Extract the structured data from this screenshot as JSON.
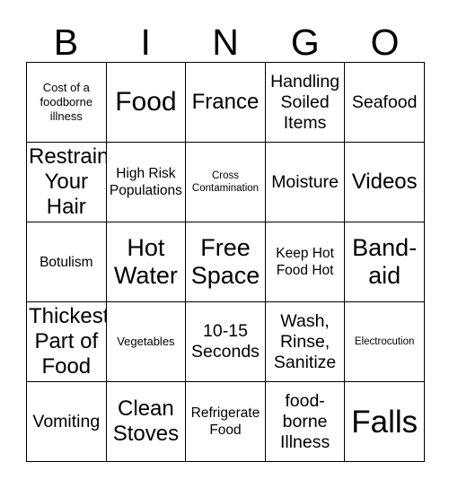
{
  "card": {
    "header_letters": [
      "B",
      "I",
      "N",
      "G",
      "O"
    ],
    "rows": [
      [
        {
          "text": "Cost of a foodborne illness",
          "size": "sz-s"
        },
        {
          "text": "Food",
          "size": "sz-3xl"
        },
        {
          "text": "France",
          "size": "sz-xl"
        },
        {
          "text": "Handling Soiled Items",
          "size": "sz-l"
        },
        {
          "text": "Seafood",
          "size": "sz-l"
        }
      ],
      [
        {
          "text": "Restrain Your Hair",
          "size": "sz-xl"
        },
        {
          "text": "High Risk Populations",
          "size": "sz-m"
        },
        {
          "text": "Cross Contamination",
          "size": "sz-xs"
        },
        {
          "text": "Moisture",
          "size": "sz-l"
        },
        {
          "text": "Videos",
          "size": "sz-xl"
        }
      ],
      [
        {
          "text": "Botulism",
          "size": "sz-m"
        },
        {
          "text": "Hot Water",
          "size": "sz-2xl"
        },
        {
          "text": "Free Space",
          "size": "sz-2xl"
        },
        {
          "text": "Keep Hot Food Hot",
          "size": "sz-m"
        },
        {
          "text": "Band-aid",
          "size": "sz-2xl"
        }
      ],
      [
        {
          "text": "Thickest Part of Food",
          "size": "sz-xl"
        },
        {
          "text": "Vegetables",
          "size": "sz-s"
        },
        {
          "text": "10-15 Seconds",
          "size": "sz-l"
        },
        {
          "text": "Wash, Rinse, Sanitize",
          "size": "sz-l"
        },
        {
          "text": "Electrocution",
          "size": "sz-xs"
        }
      ],
      [
        {
          "text": "Vomiting",
          "size": "sz-l"
        },
        {
          "text": "Clean Stoves",
          "size": "sz-xl"
        },
        {
          "text": "Refrigerate Food",
          "size": "sz-m"
        },
        {
          "text": "food-borne Illness",
          "size": "sz-l"
        },
        {
          "text": "Falls",
          "size": "sz-4xl"
        }
      ]
    ]
  },
  "colors": {
    "background": "#ffffff",
    "text": "#000000",
    "grid_line": "#000000"
  }
}
